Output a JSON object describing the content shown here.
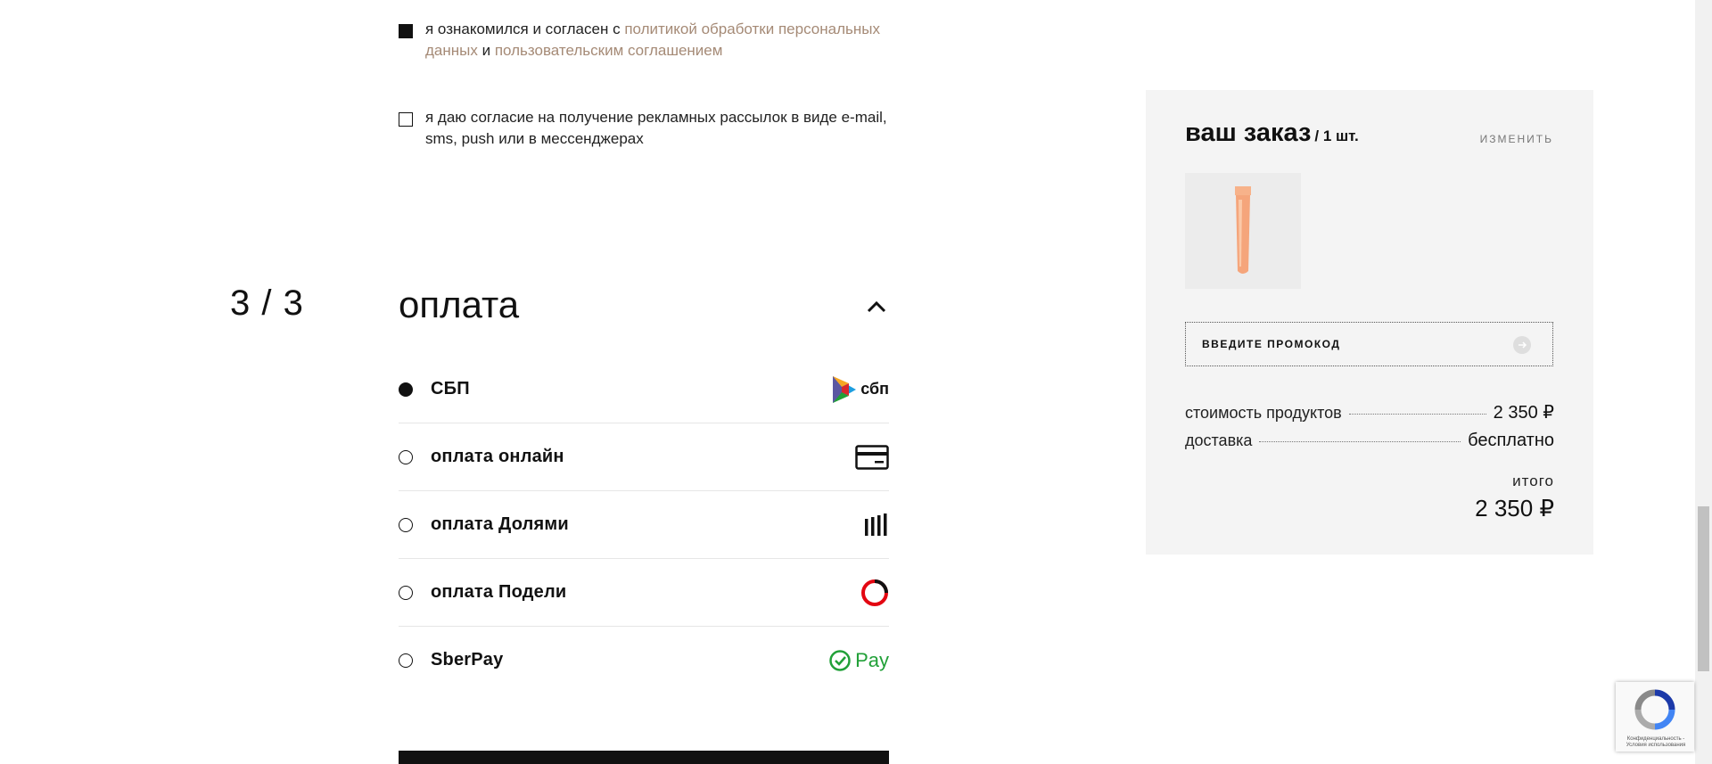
{
  "consents": [
    {
      "checked": true,
      "text_before": "я ознакомился и согласен с ",
      "link1": "политикой обработки персональных данных",
      "text_mid": " и ",
      "link2": "пользовательским соглашением"
    },
    {
      "checked": false,
      "text": "я даю согласие на получение рекламных рассылок в виде e-mail, sms, push или в мессенджерах"
    }
  ],
  "step": {
    "number": "3 / 3",
    "title": "оплата"
  },
  "payment_methods": [
    {
      "label": "СБП",
      "selected": true,
      "icon": "sbp-logo-icon",
      "icon_text": "сбп"
    },
    {
      "label": "оплата онлайн",
      "selected": false,
      "icon": "credit-card-icon"
    },
    {
      "label": "оплата Долями",
      "selected": false,
      "icon": "dolyami-icon"
    },
    {
      "label": "оплата Подели",
      "selected": false,
      "icon": "podeli-icon"
    },
    {
      "label": "SberPay",
      "selected": false,
      "icon": "sberpay-icon",
      "icon_text": "Pay"
    }
  ],
  "order": {
    "title": "ваш заказ",
    "quantity": "/ 1 шт.",
    "change_label": "ИЗМЕНИТЬ",
    "promo_placeholder": "ВВЕДИТЕ ПРОМОКОД",
    "lines": [
      {
        "label": "стоимость продуктов",
        "value": "2 350 ₽"
      },
      {
        "label": "доставка",
        "value": "бесплатно"
      }
    ],
    "total_label": "итого",
    "total_value": "2 350 ₽"
  },
  "recaptcha": {
    "text": "Конфиденциальность - Условия использования"
  },
  "colors": {
    "link": "#a58a76",
    "summary_bg": "#f4f4f4",
    "sberpay_green": "#21a038",
    "podeli_red": "#e30611"
  }
}
